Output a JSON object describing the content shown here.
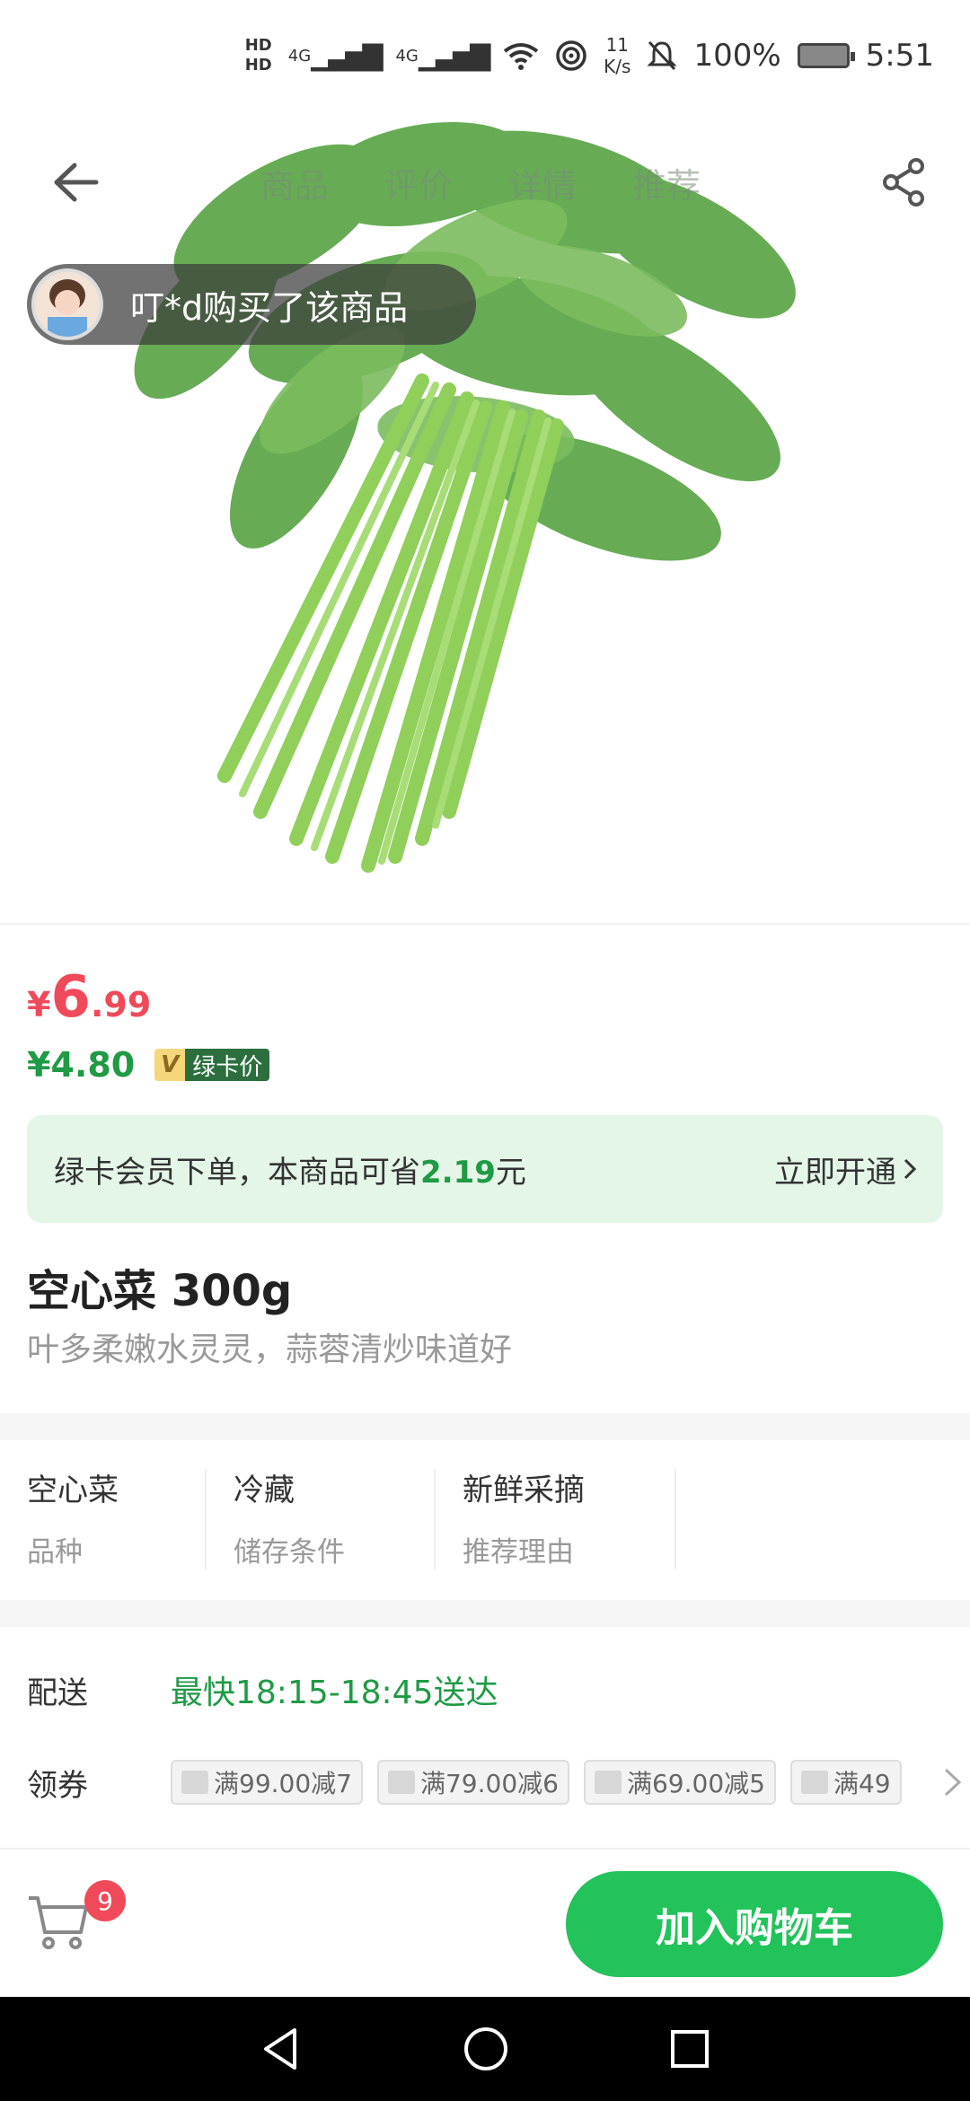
{
  "status_bar": {
    "hd1": "HD",
    "hd2": "HD",
    "net1": "4G",
    "net2": "4G",
    "speed_value": "11",
    "speed_unit": "K/s",
    "battery": "100%",
    "time": "5:51"
  },
  "nav": {
    "tabs": [
      "商品",
      "评价",
      "详情",
      "推荐"
    ]
  },
  "toast": {
    "text": "叮*d购买了该商品"
  },
  "price": {
    "currency": "¥",
    "integer": "6",
    "decimal": ".99",
    "member_price": "¥4.80",
    "vip_letter": "V",
    "vip_label": "绿卡价"
  },
  "member_banner": {
    "text_prefix": "绿卡会员下单，本商品可省",
    "amount": "2.19",
    "text_suffix": "元",
    "action": "立即开通"
  },
  "product": {
    "title": "空心菜 300g",
    "subtitle": "叶多柔嫩水灵灵，蒜蓉清炒味道好"
  },
  "attributes": [
    {
      "value": "空心菜",
      "label": "品种"
    },
    {
      "value": "冷藏",
      "label": "储存条件"
    },
    {
      "value": "新鲜采摘",
      "label": "推荐理由"
    }
  ],
  "delivery": {
    "label": "配送",
    "value": "最快18:15-18:45送达"
  },
  "coupons": {
    "label": "领券",
    "items": [
      "满99.00减7",
      "满79.00减6",
      "满69.00减5",
      "满49"
    ]
  },
  "bottom_bar": {
    "cart_count": "9",
    "add_to_cart": "加入购物车"
  },
  "colors": {
    "price_red": "#f04a5a",
    "member_green": "#1f9a45",
    "button_green": "#21c35a",
    "banner_bg": "#e4f6e8"
  }
}
